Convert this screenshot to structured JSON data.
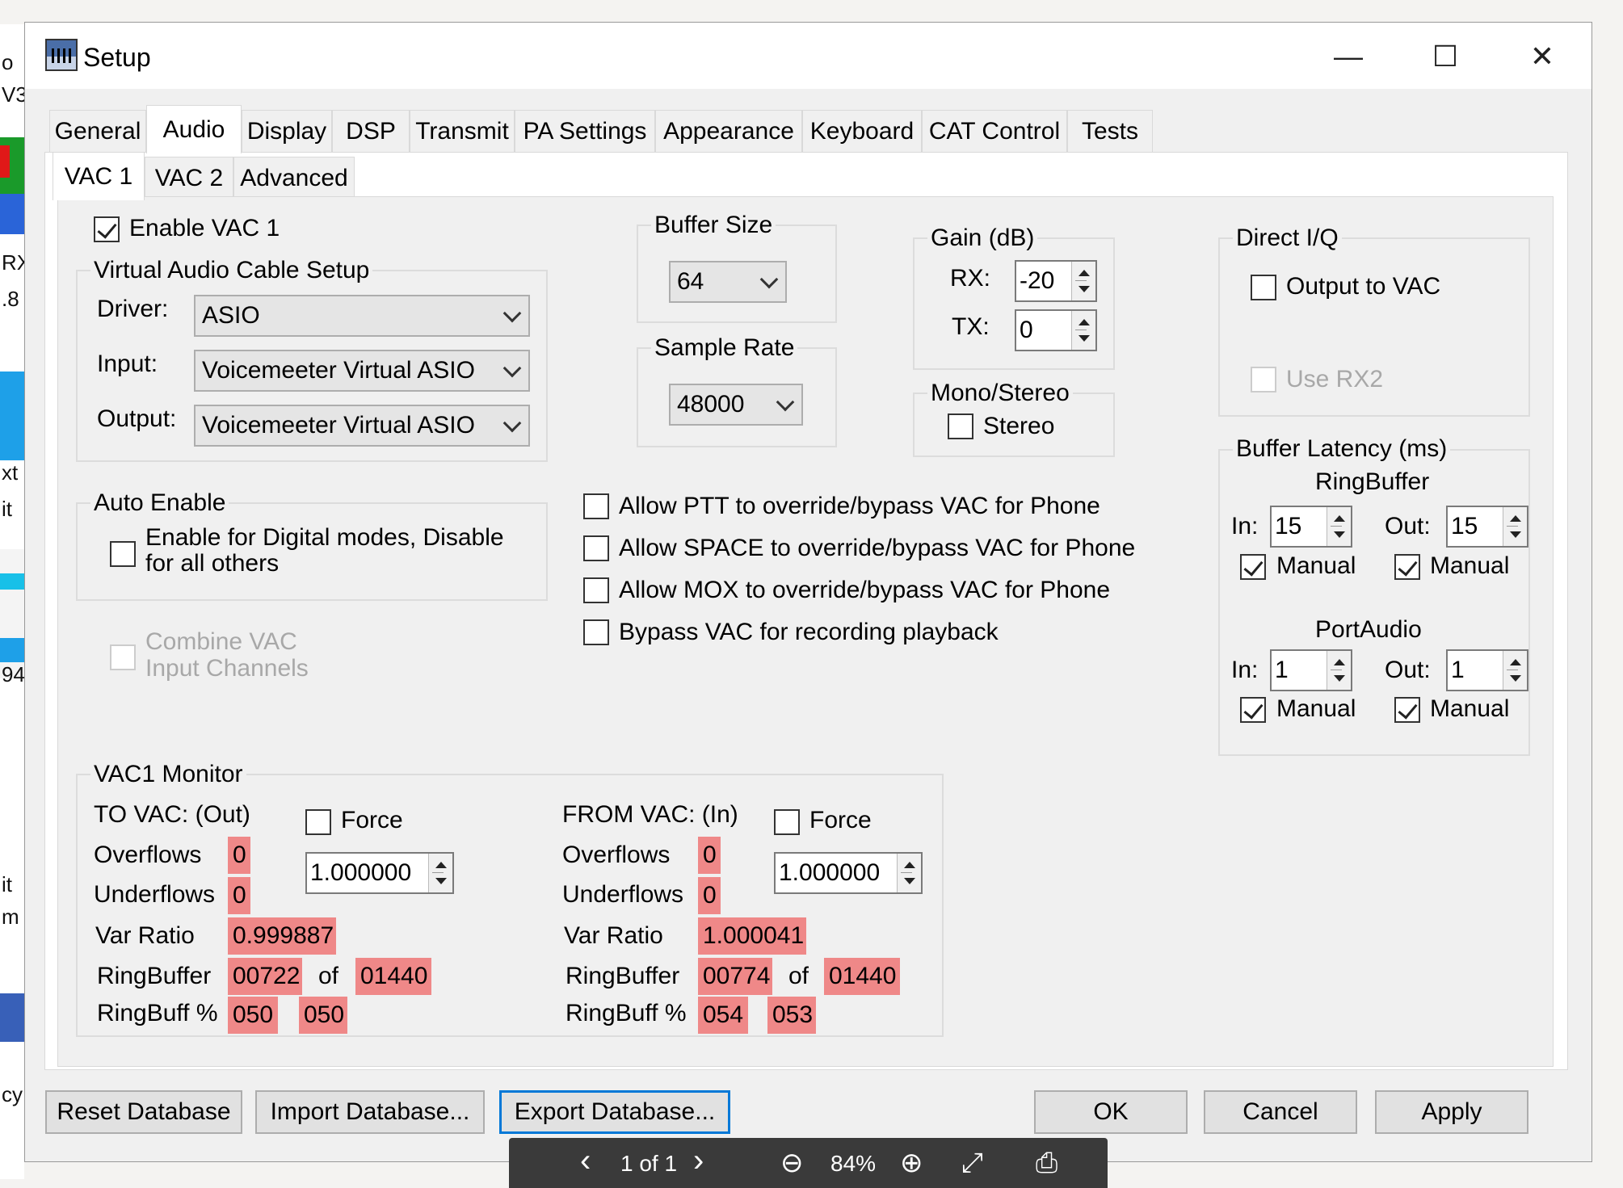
{
  "window": {
    "title": "Setup"
  },
  "window_controls": {
    "minimize": "—",
    "maximize": "☐",
    "close": "✕"
  },
  "main_tabs": [
    "General",
    "Audio",
    "Display",
    "DSP",
    "Transmit",
    "PA Settings",
    "Appearance",
    "Keyboard",
    "CAT Control",
    "Tests"
  ],
  "sub_tabs": [
    "VAC 1",
    "VAC 2",
    "Advanced"
  ],
  "enable_vac": {
    "label": "Enable VAC 1",
    "checked": true
  },
  "vac_setup": {
    "title": "Virtual Audio Cable Setup",
    "driver_label": "Driver:",
    "driver_value": "ASIO",
    "input_label": "Input:",
    "input_value": "Voicemeeter Virtual ASIO",
    "output_label": "Output:",
    "output_value": "Voicemeeter Virtual ASIO"
  },
  "buffer_size": {
    "title": "Buffer Size",
    "value": "64"
  },
  "sample_rate": {
    "title": "Sample Rate",
    "value": "48000"
  },
  "gain": {
    "title": "Gain (dB)",
    "rx_label": "RX:",
    "rx_value": "-20",
    "tx_label": "TX:",
    "tx_value": "0"
  },
  "mono_stereo": {
    "title": "Mono/Stereo",
    "stereo_label": "Stereo",
    "checked": false
  },
  "direct_iq": {
    "title": "Direct I/Q",
    "output_label": "Output to VAC",
    "use_rx2_label": "Use RX2"
  },
  "auto_enable": {
    "title": "Auto Enable",
    "line1": "Enable for Digital modes, Disable",
    "line2": "for all others"
  },
  "combine": {
    "line1": "Combine VAC",
    "line2": "Input Channels"
  },
  "overrides": {
    "ptt": "Allow PTT to override/bypass VAC for Phone",
    "space": "Allow SPACE to override/bypass VAC for Phone",
    "mox": "Allow MOX to override/bypass VAC for Phone",
    "bypass": "Bypass VAC for recording playback"
  },
  "buffer_latency": {
    "title": "Buffer Latency (ms)",
    "ringbuffer_title": "RingBuffer",
    "portaudio_title": "PortAudio",
    "in_label": "In:",
    "out_label": "Out:",
    "manual_label": "Manual",
    "rb_in": "15",
    "rb_out": "15",
    "pa_in": "1",
    "pa_out": "1"
  },
  "monitor": {
    "title": "VAC1 Monitor",
    "force_label": "Force",
    "overflows_label": "Overflows",
    "underflows_label": "Underflows",
    "var_ratio_label": "Var Ratio",
    "ringbuffer_label": "RingBuffer",
    "of_label": "of",
    "ringbuff_pct_label": "RingBuff %",
    "to": {
      "title": "TO VAC: (Out)",
      "force_value": "1.000000",
      "overflows": "0",
      "underflows": "0",
      "var_ratio": "0.999887",
      "rb_used": "00722",
      "rb_total": "01440",
      "pct1": "050",
      "pct2": "050"
    },
    "from": {
      "title": "FROM VAC: (In)",
      "force_value": "1.000000",
      "overflows": "0",
      "underflows": "0",
      "var_ratio": "1.000041",
      "rb_used": "00774",
      "rb_total": "01440",
      "pct1": "054",
      "pct2": "053"
    }
  },
  "buttons": {
    "reset": "Reset Database",
    "import": "Import Database...",
    "export": "Export Database...",
    "ok": "OK",
    "cancel": "Cancel",
    "apply": "Apply"
  },
  "viewer": {
    "prev": "‹",
    "page": "1 of 1",
    "next": "›",
    "zoom_out": "⊖",
    "zoom": "84%",
    "zoom_in": "⊕",
    "fit": "⤢",
    "print": "⎙"
  },
  "background_fragments": [
    "o",
    "V3",
    "RX",
    ".8",
    "xt",
    "it",
    "94",
    "it",
    "m",
    "cy"
  ]
}
